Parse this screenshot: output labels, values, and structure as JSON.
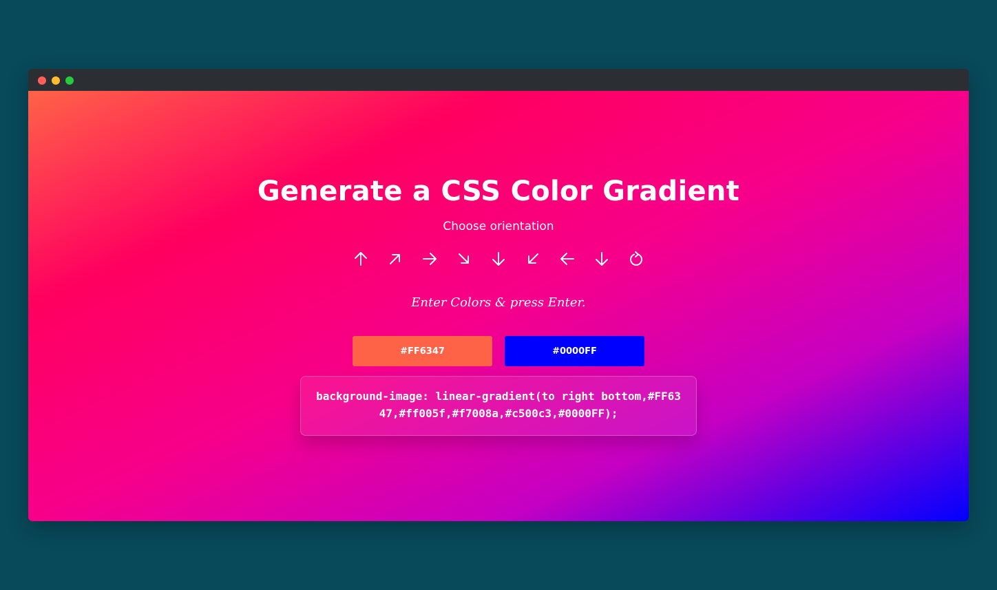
{
  "window": {
    "traffic_lights": [
      "close",
      "minimize",
      "maximize"
    ]
  },
  "main": {
    "title": "Generate a CSS Color Gradient",
    "subtitle": "Choose orientation",
    "orientations": [
      {
        "icon": "arrow-up-icon"
      },
      {
        "icon": "arrow-up-right-icon"
      },
      {
        "icon": "arrow-right-icon"
      },
      {
        "icon": "arrow-down-right-icon"
      },
      {
        "icon": "arrow-down-icon"
      },
      {
        "icon": "arrow-down-left-icon"
      },
      {
        "icon": "arrow-left-icon"
      },
      {
        "icon": "arrow-down-icon"
      },
      {
        "icon": "radial-rotate-icon"
      }
    ],
    "hint": "Enter Colors & press Enter.",
    "color1": {
      "value": "#FF6347",
      "color": "#FF6347"
    },
    "color2": {
      "value": "#0000FF",
      "color": "#0000FF"
    },
    "code": "background-image: linear-gradient(to right bottom,#FF6347,#ff005f,#f7008a,#c500c3,#0000FF);"
  },
  "colors": {
    "page_bg": "#08495a",
    "titlebar": "#2b2f33",
    "gradient": [
      "#FF6347",
      "#ff005f",
      "#f7008a",
      "#c500c3",
      "#0000FF"
    ]
  }
}
